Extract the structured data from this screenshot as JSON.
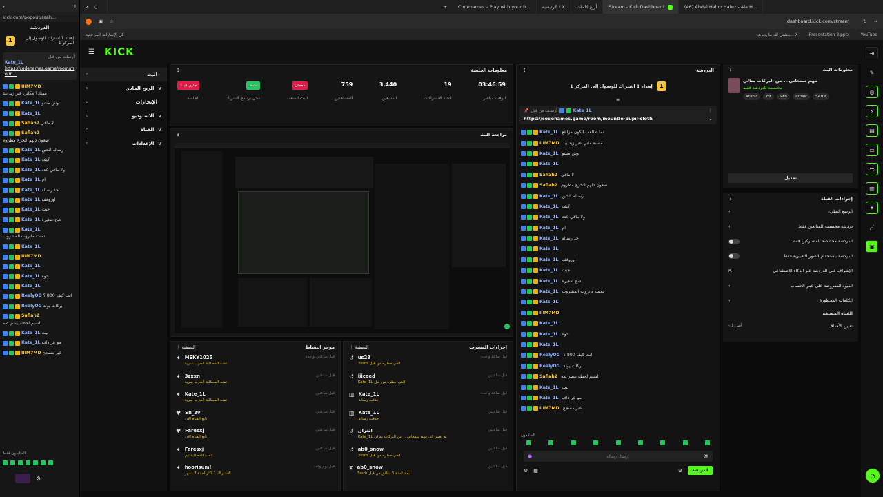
{
  "popout": {
    "url": "kick.com/popout/ssah...",
    "title": "الدردشة",
    "pinned_goal": "إهداء 1 اشتراك للوصول إلى المركز 1",
    "pinned_by": "أرسلت من قبل",
    "pinned_user": "Kate_1L",
    "pinned_link": "https://codenames.game/room/moun...",
    "messages": [
      {
        "u": "IIIM7MD",
        "m": "ممثل؟ مكاني عبر زيد بيد"
      },
      {
        "u": "Kate_1L",
        "m": "وش مشو"
      },
      {
        "u": "Kate_1L",
        "m": ""
      },
      {
        "u": "Safiah2",
        "m": "لا مافي"
      },
      {
        "u": "Safiah2",
        "m": "صعون دلهم الخرج مطروم"
      },
      {
        "u": "Kate_1L",
        "m": "رساله الحين"
      },
      {
        "u": "Kate_1L",
        "m": "كيف"
      },
      {
        "u": "Kate_1L",
        "m": "ولا مافي عدد"
      },
      {
        "u": "Kate_1L",
        "m": "ام"
      },
      {
        "u": "Kate_1L",
        "m": "خذ رسالة"
      },
      {
        "u": "Kate_1L",
        "m": "اوروفف"
      },
      {
        "u": "Kate_1L",
        "m": "جيت"
      },
      {
        "u": "Kate_1L",
        "m": "صح صغيرة"
      },
      {
        "u": "Kate_1L",
        "m": "تمنت مانروب المشروب"
      },
      {
        "u": "Kate_1L",
        "m": ""
      },
      {
        "u": "IIIM7MD",
        "m": ""
      },
      {
        "u": "Kate_1L",
        "m": ""
      },
      {
        "u": "Kate_1L",
        "m": "حوه"
      },
      {
        "u": "Kate_1L",
        "m": ""
      },
      {
        "u": "RealyOG",
        "m": "انت كيف 800 ؟"
      },
      {
        "u": "RealyOG",
        "m": "يركات بولد"
      },
      {
        "u": "Safiah2",
        "m": "الشيم لحظة يبسر طه"
      },
      {
        "u": "Kate_1L",
        "m": "بيت"
      },
      {
        "u": "Kate_1L",
        "m": "مو عر داف"
      },
      {
        "u": "IIIM7MD",
        "m": "غير مسجح"
      }
    ],
    "footer": "المتابعون فقط"
  },
  "browser": {
    "tabs": [
      "Codenames – Play with your fr...",
      "الرئيسية / X",
      "أربع كلمات",
      "Stream - Kick Dashboard",
      "(46) Abdel Halim Hafez - Ala H..."
    ],
    "address": "dashboard.kick.com/stream",
    "bookmarks_left": "كل الإشارات المرجعية",
    "bookmarks_right": [
      "Presentation 8.pptx",
      "بتشتل لك ما يحدث... X",
      "YouTube"
    ]
  },
  "brand": {
    "logo": "KICK",
    "accent": "#53fc18"
  },
  "nav": [
    {
      "label": "البث",
      "chev": ""
    },
    {
      "label": "الربح المادي",
      "chev": "v"
    },
    {
      "label": "الإنجازات",
      "chev": ""
    },
    {
      "label": "الاستوديو",
      "chev": "v"
    },
    {
      "label": "القناة",
      "chev": "v"
    },
    {
      "label": "الإعدادات",
      "chev": "v"
    }
  ],
  "session": {
    "title": "معلومات الجلسة",
    "stats": [
      {
        "value": "03:46:59",
        "label": "الوقت مباشر"
      },
      {
        "value": "19",
        "label": "اتحاد الاشتراكات"
      },
      {
        "value": "3,440",
        "label": "المتابعين"
      },
      {
        "value": "759",
        "label": "المشاهدين"
      },
      {
        "pill": "معطل",
        "label": "البث المتعدد",
        "color": "#e11d48"
      },
      {
        "pill": "نشط",
        "label": "دخل برنامج الشريك",
        "color": "#22c55e"
      },
      {
        "pill": "جاري البث",
        "label": "الجلسة",
        "color": "#e11d48"
      }
    ]
  },
  "preview": {
    "title": "مراجعة البث"
  },
  "activity": {
    "title": "موجز النشاط",
    "filter": "التصفية",
    "items": [
      {
        "who": "MEKY1025",
        "sub": "تمت المطالبة الحرب سرية",
        "t": "قبل ساعتين واحدة"
      },
      {
        "who": "3zxxn",
        "sub": "تمت المطالبة الحرب سرية",
        "t": "قبل ساعتين"
      },
      {
        "who": "Kate_1L",
        "sub": "تمت المطالبة الحرب سرية",
        "t": "قبل ساعتين"
      },
      {
        "who": "Sn_3v",
        "sub": "تابع القناة الان",
        "t": "قبل ساعتين"
      },
      {
        "who": "Faresxj",
        "sub": "تابع القناة الان",
        "t": "قبل ساعتين"
      },
      {
        "who": "Faresxj",
        "sub": "تمت المطالبة تيم",
        "t": "قبل ساعتين"
      },
      {
        "who": "hoorisum!",
        "sub": "الاشتراك 1 اكثر لمدة 3 أشهر",
        "t": "قبل يوم واحد"
      }
    ]
  },
  "modactions": {
    "title": "إجراءات المشرف",
    "filter": "التصفية",
    "items": [
      {
        "who": "us23",
        "sub": "3ssrh الغي حظره من قبل",
        "t": "قبل ساعة واحدة"
      },
      {
        "who": "iiiceed",
        "sub": "Kate_1L الغي حظره من قبل",
        "t": "قبل ساعتين"
      },
      {
        "who": "Kate_1L",
        "sub": "حذفت رسالة",
        "t": "قبل ساعة واحدة"
      },
      {
        "who": "Kate_1L",
        "sub": "حذفت رسالة",
        "t": "قبل ساعتين"
      },
      {
        "who": "الغزال",
        "sub": "Kate_1L تم تغيير إلى مهم سمعاني... من البركات يمالي",
        "t": "قبل ساعتين"
      },
      {
        "who": "ab0_snow",
        "sub": "3ssrh الغي حظره من قبل",
        "t": "قبل ساعتين"
      },
      {
        "who": "ab0_snow",
        "sub": "3ssrh أبعاد لمدة 5 دقائق من قبل",
        "t": "قبل ساعتين"
      }
    ]
  },
  "chat": {
    "title": "الدردشة",
    "goal": "إهداء 1 اشتراك للوصول إلى المركز 1",
    "pinned_by": "أرسلت من قبل",
    "pinned_user": "Kate_1L",
    "pinned_link": "https://codenames.game/room/mountle-pupil-sloth",
    "input_placeholder": "إرسال رسالة",
    "send": "الدردشة",
    "footer": "المتابعون",
    "messages": [
      {
        "u": "Kate_1L",
        "m": "نما طالعب ائكون مزاعع"
      },
      {
        "u": "IIIM7MD",
        "m": "منسة ماني عبر زيد بيد"
      },
      {
        "u": "Kate_1L",
        "m": "وش مشو"
      },
      {
        "u": "Kate_1L",
        "m": ""
      },
      {
        "u": "Safiah2",
        "m": "لا مافي"
      },
      {
        "u": "Safiah2",
        "m": "صعون دلهم الخرج مطروم"
      },
      {
        "u": "Kate_1L",
        "m": "رساله الحين"
      },
      {
        "u": "Kate_1L",
        "m": "كيف"
      },
      {
        "u": "Kate_1L",
        "m": "ولا مافي عدد"
      },
      {
        "u": "Kate_1L",
        "m": "ام"
      },
      {
        "u": "Kate_1L",
        "m": "خذ رساله"
      },
      {
        "u": "Kate_1L",
        "m": ""
      },
      {
        "u": "Kate_1L",
        "m": "اوروفف"
      },
      {
        "u": "Kate_1L",
        "m": "جيت"
      },
      {
        "u": "Kate_1L",
        "m": "صح صغيرة"
      },
      {
        "u": "Kate_1L",
        "m": "تمنت مانروب المشروب"
      },
      {
        "u": "Kate_1L",
        "m": ""
      },
      {
        "u": "IIIM7MD",
        "m": ""
      },
      {
        "u": "Kate_1L",
        "m": ""
      },
      {
        "u": "Kate_1L",
        "m": "حوه"
      },
      {
        "u": "Kate_1L",
        "m": ""
      },
      {
        "u": "RealyOG",
        "m": "انت كيف 800 ؟"
      },
      {
        "u": "RealyOG",
        "m": "بركات يولد"
      },
      {
        "u": "Safiah2",
        "m": "الشيم لحظة يبسر طه"
      },
      {
        "u": "Kate_1L",
        "m": "بيت"
      },
      {
        "u": "Kate_1L",
        "m": "مو عر داف"
      },
      {
        "u": "IIIM7MD",
        "m": "غير مسجح"
      }
    ]
  },
  "streaminfo": {
    "title": "معلومات البث",
    "stream_title": "مهم سمعاني... من البركات يمالي",
    "category": "مخصصة للدردشة فقط",
    "tags": [
      "SAHM",
      "arbaic",
      "SXB",
      "mt",
      "Arabic"
    ],
    "edit": "تعديل"
  },
  "channelactions": {
    "title": "إجراءات القناة",
    "items": [
      {
        "label": "الوضع البطيء",
        "ctl": "chev"
      },
      {
        "label": "دردشة مخصصة للمتابعين فقط",
        "ctl": "chev"
      },
      {
        "label": "الدردشة مخصصة للمشتركين فقط",
        "ctl": "toggle"
      },
      {
        "label": "الدردشة باستخدام الصور التعبيرية فقط",
        "ctl": "toggle"
      },
      {
        "label": "الإشراف على الدردشة عبر الذكاء الاصطناعي",
        "ctl": "link"
      },
      {
        "label": "القيود المفروضة على عمر الحساب",
        "ctl": "chev"
      },
      {
        "label": "الكلمات المحظورة",
        "ctl": "chev"
      }
    ],
    "section": "القناة المضيفة",
    "host": "تعيين الأهداف",
    "host_val": "أصل 1"
  }
}
